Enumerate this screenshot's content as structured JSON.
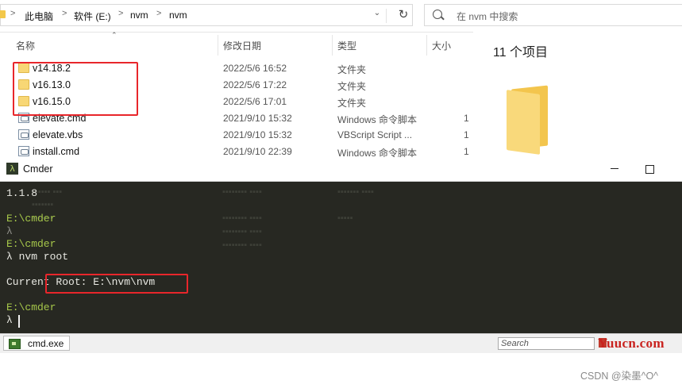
{
  "explorer": {
    "breadcrumb": [
      "此电脑",
      "软件 (E:)",
      "nvm",
      "nvm"
    ],
    "search_placeholder": "在 nvm 中搜索",
    "columns": {
      "name": "名称",
      "date": "修改日期",
      "type": "类型",
      "size": "大小"
    },
    "files": [
      {
        "name": "v14.18.2",
        "date": "2022/5/6 16:52",
        "type": "文件夹",
        "size": "",
        "icon": "folder-icon"
      },
      {
        "name": "v16.13.0",
        "date": "2022/5/6 17:22",
        "type": "文件夹",
        "size": "",
        "icon": "folder-icon"
      },
      {
        "name": "v16.15.0",
        "date": "2022/5/6 17:01",
        "type": "文件夹",
        "size": "",
        "icon": "folder-icon"
      },
      {
        "name": "elevate.cmd",
        "date": "2021/9/10 15:32",
        "type": "Windows 命令脚本",
        "size": "1",
        "icon": "cmd-file-icon"
      },
      {
        "name": "elevate.vbs",
        "date": "2021/9/10 15:32",
        "type": "VBScript Script ...",
        "size": "1",
        "icon": "vbs-file-icon"
      },
      {
        "name": "install.cmd",
        "date": "2021/9/10 22:39",
        "type": "Windows 命令脚本",
        "size": "1",
        "icon": "cmd-file-icon"
      }
    ],
    "item_count": "11 个项目"
  },
  "cmder": {
    "title": "Cmder",
    "lines": [
      {
        "text": "1.1.8",
        "color": "white"
      },
      {
        "text": "E:\\cmder",
        "color": "green"
      },
      {
        "text": "λ",
        "color": "gray"
      },
      {
        "text": "E:\\cmder",
        "color": "green"
      },
      {
        "text": "λ nvm root",
        "color": "white"
      },
      {
        "text": "Current Root: E:\\nvm\\nvm",
        "color": "white"
      },
      {
        "text": "E:\\cmder",
        "color": "green"
      },
      {
        "text": "λ",
        "color": "white"
      }
    ],
    "tab_label": "cmd.exe",
    "search_placeholder": "Search"
  },
  "watermarks": {
    "yuucn": "Yuucn.com",
    "csdn": "CSDN @染墨^O^"
  },
  "colors": {
    "highlight_box": "#e8262b",
    "terminal_bg": "#272822",
    "prompt_green": "#a6c74a"
  }
}
